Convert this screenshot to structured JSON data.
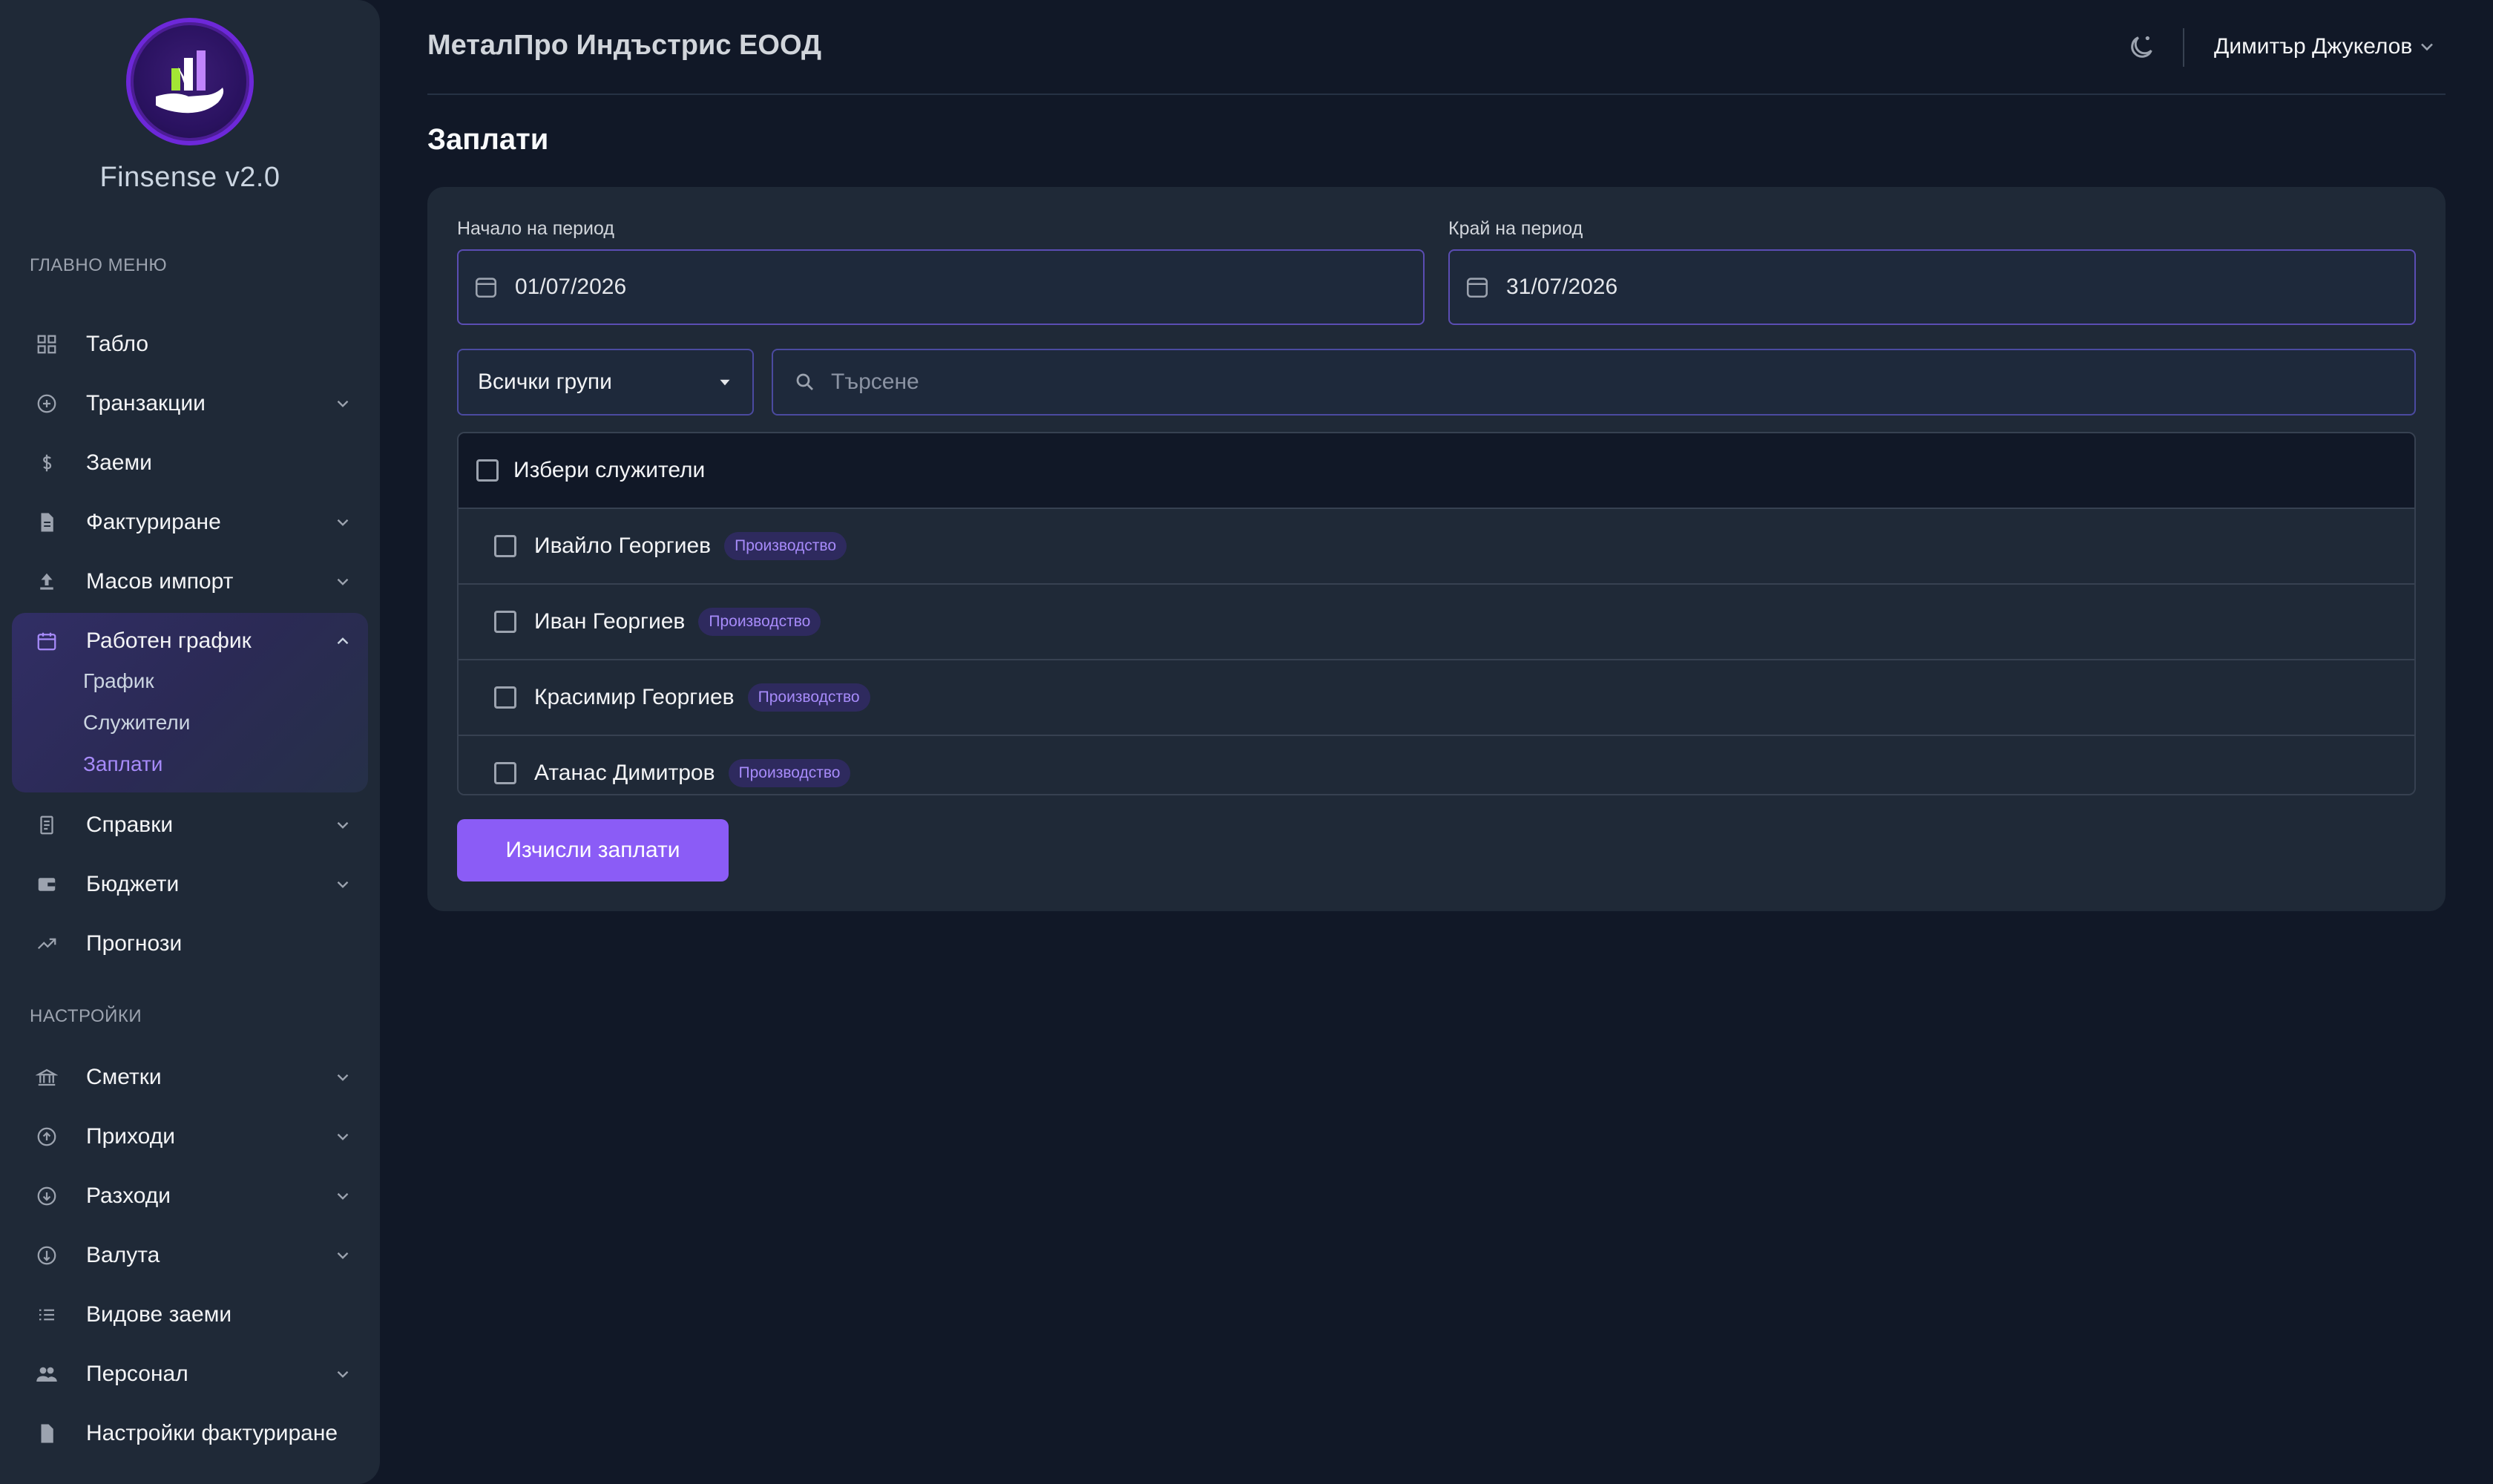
{
  "app": {
    "name": "Finsense v2.0"
  },
  "sidebar": {
    "main_section": "ГЛАВНО МЕНЮ",
    "settings_section": "НАСТРОЙКИ",
    "main_items": [
      {
        "label": "Табло",
        "icon": "grid-icon"
      },
      {
        "label": "Транзакции",
        "icon": "plus-circle-icon"
      },
      {
        "label": "Заеми",
        "icon": "dollar-icon"
      },
      {
        "label": "Фактуриране",
        "icon": "document-icon"
      },
      {
        "label": "Масов импорт",
        "icon": "upload-icon"
      },
      {
        "label": "Работен график",
        "icon": "calendar-icon"
      },
      {
        "label": "Справки",
        "icon": "report-icon"
      },
      {
        "label": "Бюджети",
        "icon": "wallet-icon"
      },
      {
        "label": "Прогнози",
        "icon": "trend-icon"
      }
    ],
    "sub_items": [
      {
        "label": "График"
      },
      {
        "label": "Служители"
      },
      {
        "label": "Заплати"
      }
    ],
    "settings_items": [
      {
        "label": "Сметки",
        "icon": "bank-icon"
      },
      {
        "label": "Приходи",
        "icon": "arrow-up-circle-icon"
      },
      {
        "label": "Разходи",
        "icon": "arrow-down-circle-icon"
      },
      {
        "label": "Валута",
        "icon": "currency-icon"
      },
      {
        "label": "Видове заеми",
        "icon": "list-icon"
      },
      {
        "label": "Персонал",
        "icon": "people-icon"
      },
      {
        "label": "Настройки фактуриране",
        "icon": "file-icon"
      }
    ]
  },
  "header": {
    "company": "МеталПро Индъстрис ЕООД",
    "user": "Димитър Джукелов"
  },
  "page": {
    "title": "Заплати"
  },
  "form": {
    "start_label": "Начало на период",
    "start_value": "01/07/2026",
    "end_label": "Край на период",
    "end_value": "31/07/2026",
    "group_select": "Всички групи",
    "search_placeholder": "Търсене",
    "select_all_label": "Избери служители",
    "employees": [
      {
        "name": "Ивайло Георгиев",
        "group": "Производство"
      },
      {
        "name": "Иван Георгиев",
        "group": "Производство"
      },
      {
        "name": "Красимир Георгиев",
        "group": "Производство"
      },
      {
        "name": "Атанас Димитров",
        "group": "Производство"
      }
    ],
    "calculate_button": "Изчисли заплати"
  },
  "colors": {
    "accent": "#8b5cf6",
    "accent_text": "#a78bfa",
    "background": "#111827",
    "panel": "#1f2937"
  }
}
